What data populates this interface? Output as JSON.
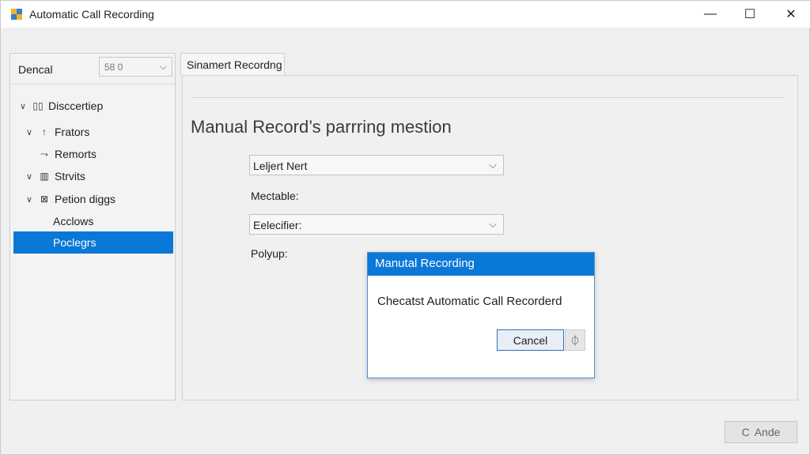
{
  "window": {
    "title": "Automatic Call Recording",
    "controls": {
      "minimize": "—",
      "maximize": "☐",
      "close": "✕"
    }
  },
  "left_panel": {
    "label": "Dencal",
    "select_value": "58 0",
    "tree": [
      {
        "label": "Disccertiep",
        "expander": "∨",
        "icon": "▯▯"
      },
      {
        "label": "Frators",
        "expander": "∨",
        "icon": "↑"
      },
      {
        "label": "Remorts",
        "expander": "",
        "icon": "⤳"
      },
      {
        "label": "Strvits",
        "expander": "∨",
        "icon": "▥"
      },
      {
        "label": "Petion diggs",
        "expander": "∨",
        "icon": "⊠"
      },
      {
        "label": "Acclows",
        "expander": "",
        "icon": ""
      }
    ],
    "selected_item": "Poclegrs"
  },
  "tab": {
    "label": "Sinamert Recordng"
  },
  "content": {
    "heading": "Manual Record’s parrring mestion",
    "combo1_value": "Leljert Nert",
    "field_label1": "Mectable:",
    "combo2_value": "Eelecifier:",
    "field_label2": "Polyup:"
  },
  "dialog": {
    "title": "Manutal Recording",
    "message": "Checatst Automatic Call Recorderd",
    "cancel_label": "Cancel",
    "extra_glyph": "⏀"
  },
  "bottom_button": {
    "label": "Ande",
    "icon": "C"
  },
  "colors": {
    "accent": "#0a78d7"
  }
}
